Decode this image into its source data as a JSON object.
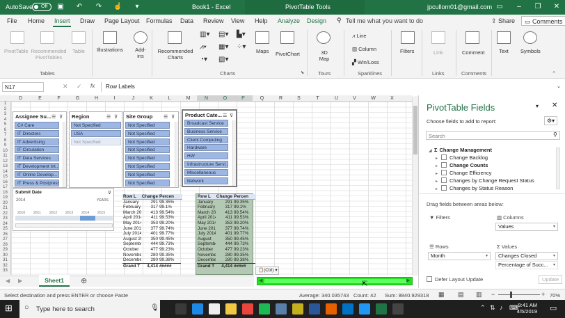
{
  "title_bar": {
    "autosave_label": "AutoSave",
    "autosave_state": "Off",
    "doc_title": "Book1 - Excel",
    "context_title": "PivotTable Tools",
    "user": "jpcullom01@gmail.com"
  },
  "tabs": [
    "File",
    "Home",
    "Insert",
    "Draw",
    "Page Layout",
    "Formulas",
    "Data",
    "Review",
    "View",
    "Help",
    "Analyze",
    "Design"
  ],
  "active_tab": "Insert",
  "tell_me": "Tell me what you want to do",
  "share_label": "Share",
  "comments_label": "Comments",
  "ribbon": {
    "pivottable": "PivotTable",
    "recommended_pivottables": "Recommended PivotTables",
    "table": "Table",
    "illustrations": "Illustrations",
    "addins": "Add-ins",
    "recommended_charts": "Recommended Charts",
    "maps": "Maps",
    "pivotchart": "PivotChart",
    "map3d": "3D Map",
    "line": "Line",
    "column": "Column",
    "winloss": "Win/Loss",
    "filters": "Filters",
    "link": "Link",
    "comment": "Comment",
    "text": "Text",
    "symbols": "Symbols",
    "groups": {
      "tables": "Tables",
      "charts": "Charts",
      "tours": "Tours",
      "sparklines": "Sparklines",
      "links": "Links",
      "comments": "Comments"
    }
  },
  "formula_bar": {
    "name_box": "N17",
    "fx": "fx",
    "content": "Row Labels"
  },
  "columns": [
    "D",
    "E",
    "F",
    "G",
    "H",
    "I",
    "J",
    "K",
    "L",
    "M",
    "N",
    "O",
    "P",
    "Q",
    "R",
    "S",
    "T",
    "U",
    "V",
    "W",
    "X"
  ],
  "rows": [
    "1",
    "2",
    "3",
    "4",
    "5",
    "6",
    "7",
    "8",
    "9",
    "10",
    "11",
    "12",
    "13",
    "14",
    "15",
    "16",
    "17",
    "18",
    "19",
    "20",
    "21",
    "22",
    "23",
    "24",
    "25",
    "26",
    "27",
    "28",
    "29",
    "30",
    "31",
    "32",
    "33"
  ],
  "slicers": {
    "assignee": {
      "title": "Assignee Su...",
      "items": [
        "C# Care",
        "IT Directors",
        "IT Advertising",
        "IT Circulation",
        "IT Data Services",
        "IT Development Int...",
        "IT Online Develop...",
        "IT Press & Postpress"
      ]
    },
    "region": {
      "title": "Region",
      "items": [
        "Not Specified",
        "USA",
        "Not Specified"
      ]
    },
    "site_group": {
      "title": "Site Group",
      "items": [
        "Not Specified",
        "Not Specified",
        "Not Specified",
        "Not Specified",
        "Not Specified",
        "Not Specified",
        "Not Specified",
        "Not Specified"
      ]
    },
    "product_category": {
      "title": "Product Cate...",
      "items": [
        "Broadcast Service",
        "Business Service",
        "Client Computing",
        "Hardware",
        "HW",
        "Infrastructure Servi...",
        "Miscellaneous",
        "Network"
      ]
    }
  },
  "timeline": {
    "title": "Submit Date",
    "scale": "YEARS",
    "year": "2014",
    "ticks": [
      "2010",
      "2011",
      "2012",
      "2013",
      "2014",
      "2015"
    ]
  },
  "pivot1": {
    "headers": [
      "Row L",
      "Change",
      "Percen"
    ],
    "rows": [
      [
        "January",
        "291",
        "99.35%"
      ],
      [
        "February",
        "317",
        "99.1%"
      ],
      [
        "March 2014",
        "413",
        "99.54%"
      ],
      [
        "April 2014",
        "411",
        "99.53%"
      ],
      [
        "May 2014",
        "353",
        "99.20%"
      ],
      [
        "June 2014",
        "377",
        "99.74%"
      ],
      [
        "July 2014",
        "401",
        "99.77%"
      ],
      [
        "August 2014",
        "350",
        "99.45%"
      ],
      [
        "September",
        "444",
        "99.73%"
      ],
      [
        "October",
        "477",
        "99.23%"
      ],
      [
        "November",
        "280",
        "99.35%"
      ],
      [
        "December",
        "280",
        "99.38%"
      ]
    ],
    "total": [
      "Grand T",
      "4,414",
      "#####"
    ]
  },
  "pivot2": {
    "headers": [
      "Row L",
      "Change",
      "Percen"
    ],
    "rows": [
      [
        "January",
        "291",
        "99.35%"
      ],
      [
        "February",
        "317",
        "99.1%"
      ],
      [
        "March 2014",
        "413",
        "99.54%"
      ],
      [
        "April 2014",
        "411",
        "99.53%"
      ],
      [
        "May 2014",
        "353",
        "99.20%"
      ],
      [
        "June 2014",
        "377",
        "99.74%"
      ],
      [
        "July 2014",
        "401",
        "99.77%"
      ],
      [
        "August",
        "350",
        "99.45%"
      ],
      [
        "September",
        "444",
        "99.73%"
      ],
      [
        "October",
        "477",
        "99.23%"
      ],
      [
        "November",
        "280",
        "99.35%"
      ],
      [
        "December",
        "280",
        "99.38%"
      ]
    ],
    "total": [
      "Grand T",
      "4,414",
      "#####"
    ]
  },
  "paste_ctrl": "(Ctrl)",
  "sheet_tab": "Sheet1",
  "status": {
    "message": "Select destination and press ENTER or choose Paste",
    "average": "Average: 340.035743",
    "count": "Count: 42",
    "sum": "Sum: 8840.929318",
    "zoom": "70%"
  },
  "pane": {
    "title": "PivotTable Fields",
    "subtitle": "Choose fields to add to report:",
    "search_placeholder": "Search",
    "fields": [
      {
        "label": "Change Management",
        "kind": "table",
        "bold": true
      },
      {
        "label": "Change Backlog",
        "kind": "field",
        "bold": false
      },
      {
        "label": "Change Counts",
        "kind": "field",
        "bold": true
      },
      {
        "label": "Change Efficiency",
        "kind": "field",
        "bold": false
      },
      {
        "label": "Changes by Change Request Status",
        "kind": "field",
        "bold": false
      },
      {
        "label": "Changes by Status Reason",
        "kind": "field",
        "bold": false
      }
    ],
    "drag_label": "Drag fields between areas below:",
    "filters_label": "Filters",
    "columns_label": "Columns",
    "columns_value": "Values",
    "rows_label": "Rows",
    "rows_value": "Month",
    "values_label": "Values",
    "values_items": [
      "Changes Closed",
      "Percentage of Succ..."
    ],
    "defer_label": "Defer Layout Update",
    "update_label": "Update"
  },
  "taskbar": {
    "search_placeholder": "Type here to search",
    "time": "9:41 AM",
    "date": "4/5/2019"
  }
}
